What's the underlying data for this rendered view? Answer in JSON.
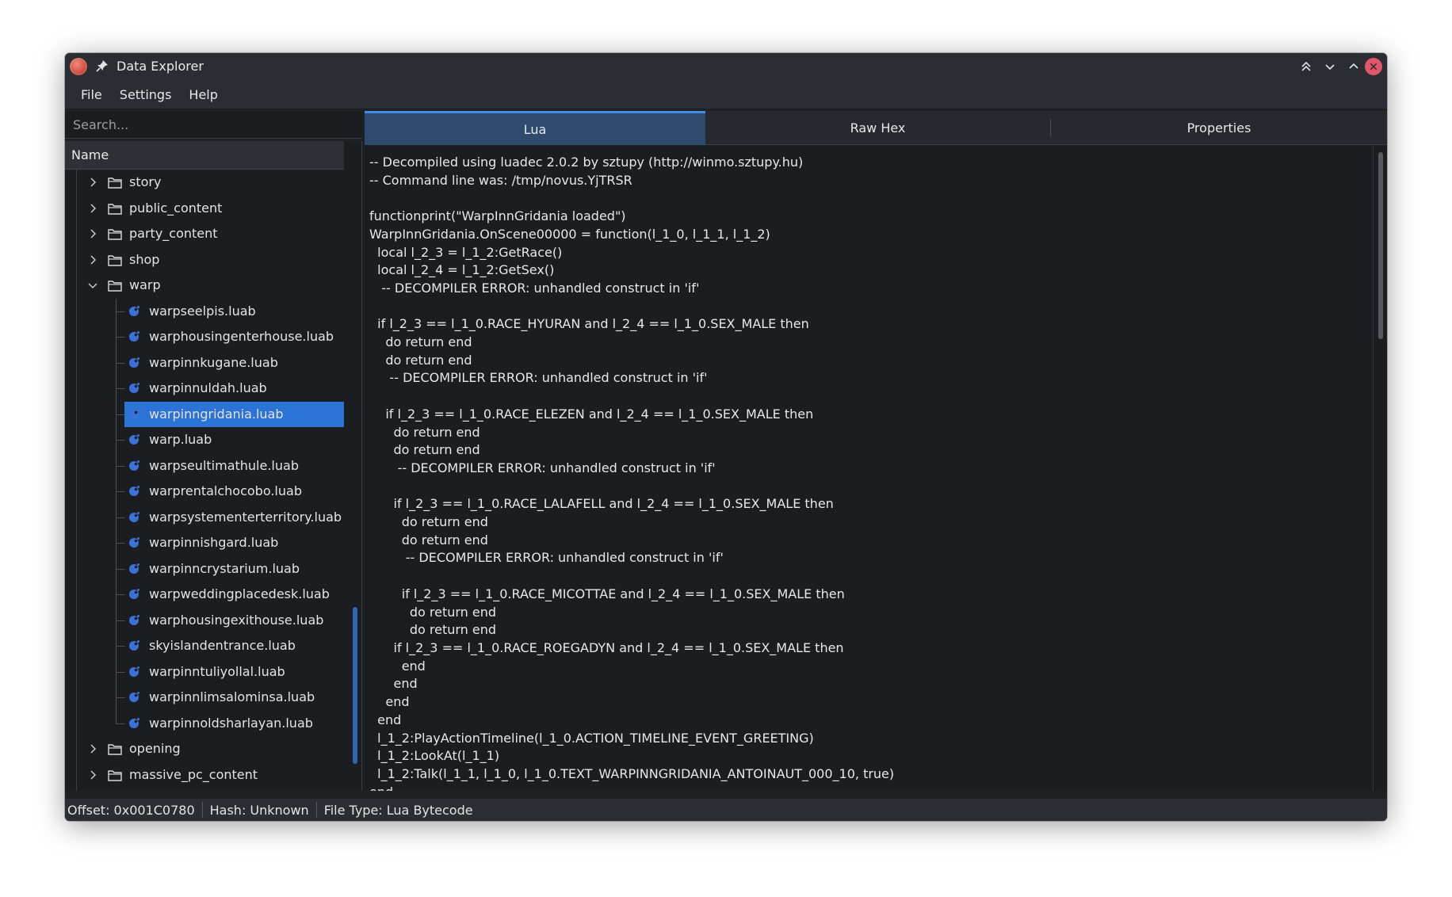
{
  "window": {
    "title": "Data Explorer"
  },
  "menu": {
    "items": [
      "File",
      "Settings",
      "Help"
    ]
  },
  "search": {
    "placeholder": "Search..."
  },
  "tree": {
    "header": "Name",
    "rows": [
      {
        "type": "folder",
        "label": "story",
        "expanded": false
      },
      {
        "type": "folder",
        "label": "public_content",
        "expanded": false
      },
      {
        "type": "folder",
        "label": "party_content",
        "expanded": false
      },
      {
        "type": "folder",
        "label": "shop",
        "expanded": false
      },
      {
        "type": "folder",
        "label": "warp",
        "expanded": true
      },
      {
        "type": "file",
        "label": "warpseelpis.luab"
      },
      {
        "type": "file",
        "label": "warphousingenterhouse.luab"
      },
      {
        "type": "file",
        "label": "warpinnkugane.luab"
      },
      {
        "type": "file",
        "label": "warpinnuldah.luab"
      },
      {
        "type": "file",
        "label": "warpinngridania.luab",
        "selected": true
      },
      {
        "type": "file",
        "label": "warp.luab"
      },
      {
        "type": "file",
        "label": "warpseultimathule.luab"
      },
      {
        "type": "file",
        "label": "warprentalchocobo.luab"
      },
      {
        "type": "file",
        "label": "warpsystementerterritory.luab"
      },
      {
        "type": "file",
        "label": "warpinnishgard.luab"
      },
      {
        "type": "file",
        "label": "warpinncrystarium.luab"
      },
      {
        "type": "file",
        "label": "warpweddingplacedesk.luab"
      },
      {
        "type": "file",
        "label": "warphousingexithouse.luab"
      },
      {
        "type": "file",
        "label": "skyislandentrance.luab"
      },
      {
        "type": "file",
        "label": "warpinntuliyollal.luab"
      },
      {
        "type": "file",
        "label": "warpinnlimsalominsa.luab"
      },
      {
        "type": "file",
        "label": "warpinnoldsharlayan.luab"
      },
      {
        "type": "folder",
        "label": "opening",
        "expanded": false
      },
      {
        "type": "folder",
        "label": "massive_pc_content",
        "expanded": false
      }
    ]
  },
  "tabs": [
    {
      "label": "Lua",
      "active": true
    },
    {
      "label": "Raw Hex",
      "active": false
    },
    {
      "label": "Properties",
      "active": false
    }
  ],
  "code": {
    "lines": [
      "-- Decompiled using luadec 2.0.2 by sztupy (http://winmo.sztupy.hu)",
      "-- Command line was: /tmp/novus.YjTRSR",
      "",
      "functionprint(\"WarpInnGridania loaded\")",
      "WarpInnGridania.OnScene00000 = function(l_1_0, l_1_1, l_1_2)",
      "  local l_2_3 = l_1_2:GetRace()",
      "  local l_2_4 = l_1_2:GetSex()",
      "   -- DECOMPILER ERROR: unhandled construct in 'if'",
      "",
      "  if l_2_3 == l_1_0.RACE_HYURAN and l_2_4 == l_1_0.SEX_MALE then",
      "    do return end",
      "    do return end",
      "     -- DECOMPILER ERROR: unhandled construct in 'if'",
      "",
      "    if l_2_3 == l_1_0.RACE_ELEZEN and l_2_4 == l_1_0.SEX_MALE then",
      "      do return end",
      "      do return end",
      "       -- DECOMPILER ERROR: unhandled construct in 'if'",
      "",
      "      if l_2_3 == l_1_0.RACE_LALAFELL and l_2_4 == l_1_0.SEX_MALE then",
      "        do return end",
      "        do return end",
      "         -- DECOMPILER ERROR: unhandled construct in 'if'",
      "",
      "        if l_2_3 == l_1_0.RACE_MICOTTAE and l_2_4 == l_1_0.SEX_MALE then",
      "          do return end",
      "          do return end",
      "      if l_2_3 == l_1_0.RACE_ROEGADYN and l_2_4 == l_1_0.SEX_MALE then",
      "        end",
      "      end",
      "    end",
      "  end",
      "  l_1_2:PlayActionTimeline(l_1_0.ACTION_TIMELINE_EVENT_GREETING)",
      "  l_1_2:LookAt(l_1_1)",
      "  l_1_2:Talk(l_1_1, l_1_0, l_1_0.TEXT_WARPINNGRIDANIA_ANTOINAUT_000_10, true)",
      "end"
    ]
  },
  "status": {
    "offset": "Offset: 0x001C0780",
    "hash": "Hash: Unknown",
    "file_type": "File Type: Lua Bytecode"
  },
  "colors": {
    "accent": "#2b73d6",
    "close": "#e0566a",
    "window_bg": "#1e2124"
  }
}
